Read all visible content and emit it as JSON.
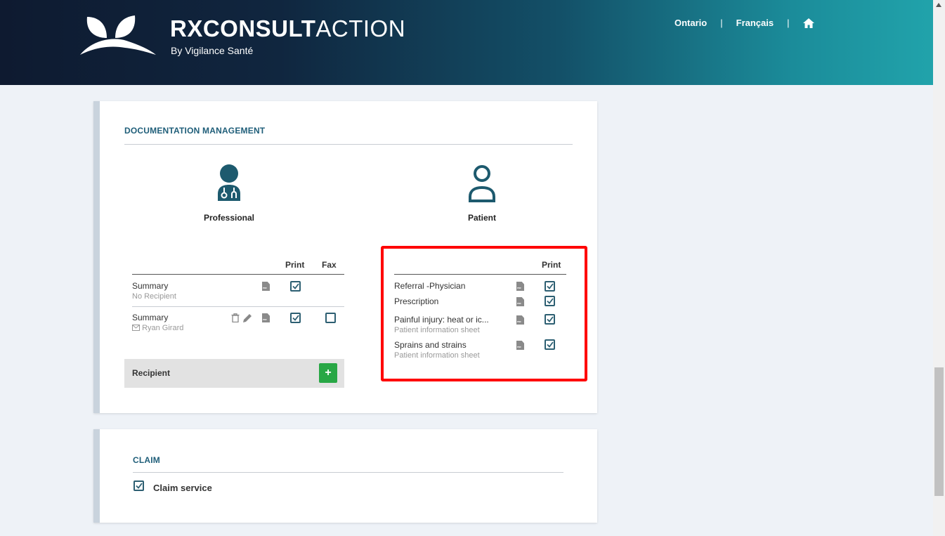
{
  "header": {
    "brand_bold": "RXCONSULT",
    "brand_light": "ACTION",
    "brand_sub": "By Vigilance Santé",
    "nav": {
      "province": "Ontario",
      "language": "Français",
      "separator": "|",
      "home_icon": "home-icon"
    },
    "colors": {
      "gradient_start": "#0e1a30",
      "gradient_end": "#21a3ab"
    }
  },
  "documentation": {
    "title": "DOCUMENTATION MANAGEMENT",
    "professional": {
      "label": "Professional",
      "icon": "doctor-icon",
      "columns": {
        "print": "Print",
        "fax": "Fax"
      },
      "rows": [
        {
          "name": "Summary",
          "sub": "No Recipient",
          "print": true
        },
        {
          "name": "Summary",
          "sub": "Ryan Girard",
          "print": true,
          "fax": false
        }
      ],
      "recipient": {
        "label": "Recipient",
        "add": "+"
      }
    },
    "patient": {
      "label": "Patient",
      "icon": "patient-icon",
      "columns": {
        "print": "Print"
      },
      "rows": [
        {
          "name": "Referral -Physician",
          "print": true
        },
        {
          "name": "Prescription",
          "print": true
        },
        {
          "name": "Painful injury: heat or ic...",
          "sub": "Patient information sheet",
          "print": true
        },
        {
          "name": "Sprains and strains",
          "sub": "Patient information sheet",
          "print": true
        }
      ]
    }
  },
  "claim": {
    "title": "CLAIM",
    "service": {
      "label": "Claim service",
      "checked": true
    }
  },
  "accent": {
    "checkbox": "#2d5f72",
    "title": "#1f5e79",
    "add_button": "#28a745",
    "highlight": "#ff0000"
  }
}
